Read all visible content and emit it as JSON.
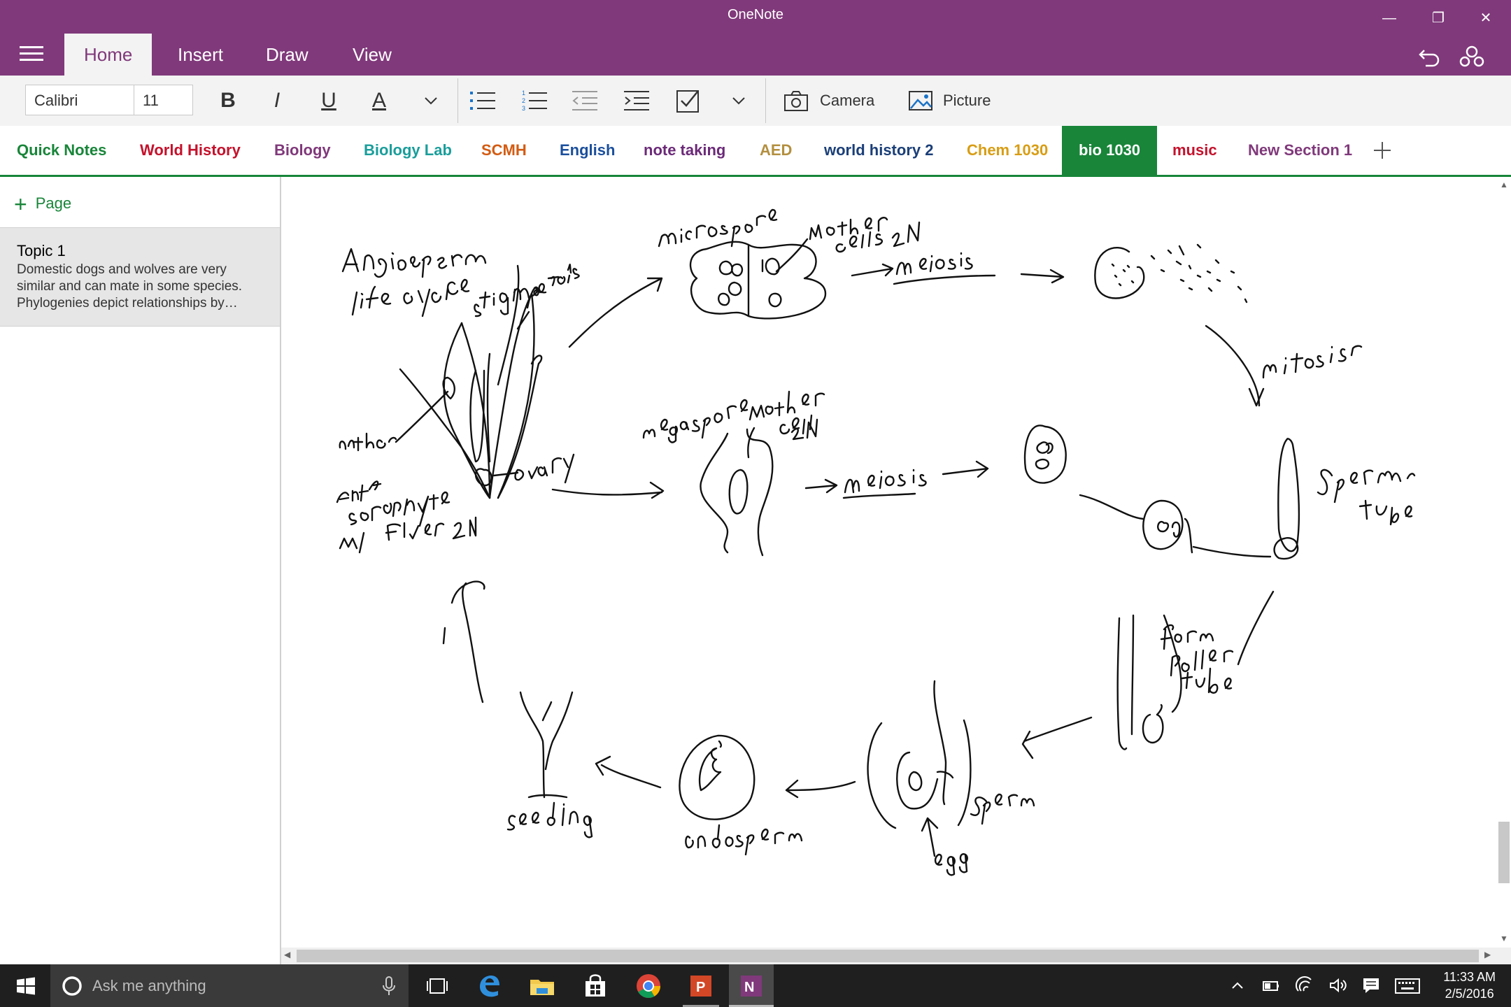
{
  "app": {
    "title": "OneNote"
  },
  "window_controls": {
    "minimize": "—",
    "restore": "❐",
    "close": "✕"
  },
  "tabs": [
    {
      "label": "Home",
      "active": true
    },
    {
      "label": "Insert"
    },
    {
      "label": "Draw"
    },
    {
      "label": "View"
    }
  ],
  "ribbon": {
    "font_name": "Calibri",
    "font_size": "11",
    "bold": "B",
    "italic": "I",
    "underline": "U",
    "font_color": "A",
    "camera_label": "Camera",
    "picture_label": "Picture"
  },
  "sections": [
    {
      "label": "Quick Notes",
      "color": "#188539"
    },
    {
      "label": "World History",
      "color": "#c4122c"
    },
    {
      "label": "Biology",
      "color": "#80397b"
    },
    {
      "label": "Biology Lab",
      "color": "#1a9e9b"
    },
    {
      "label": "SCMH",
      "color": "#d35b12"
    },
    {
      "label": "English",
      "color": "#1b4f9c"
    },
    {
      "label": "note taking",
      "color": "#6b2a78"
    },
    {
      "label": "AED",
      "color": "#b38f3f"
    },
    {
      "label": "world history 2",
      "color": "#1b3f78"
    },
    {
      "label": "Chem 1030",
      "color": "#d89d14"
    },
    {
      "label": "bio 1030",
      "color": "#ffffff",
      "active": true
    },
    {
      "label": "music",
      "color": "#c4122c"
    },
    {
      "label": "New Section 1",
      "color": "#80397b"
    }
  ],
  "pages": {
    "add_label": "Page",
    "items": [
      {
        "title": "Topic 1",
        "preview": "Domestic dogs and wolves are very similar and can mate in some species. Phylogenies depict relationships by…"
      }
    ]
  },
  "ink_labels": [
    "Angiosperm",
    "life cycle",
    "stigma",
    "petals",
    "anther",
    "Adult sporophyte",
    "w/ flower 2N",
    "ovary",
    "microspore",
    "mother cells 2N",
    "meiosis",
    "mitosis",
    "megaspore",
    "mother cell 2N",
    "meiosis",
    "sperm tube",
    "egg",
    "form pollen tube",
    "sperm",
    "egg",
    "endosperm",
    "seedling"
  ],
  "taskbar": {
    "search_placeholder": "Ask me anything",
    "time": "11:33 AM",
    "date": "2/5/2016"
  },
  "colors": {
    "titlebar": "#80397b",
    "section_active": "#188539"
  }
}
